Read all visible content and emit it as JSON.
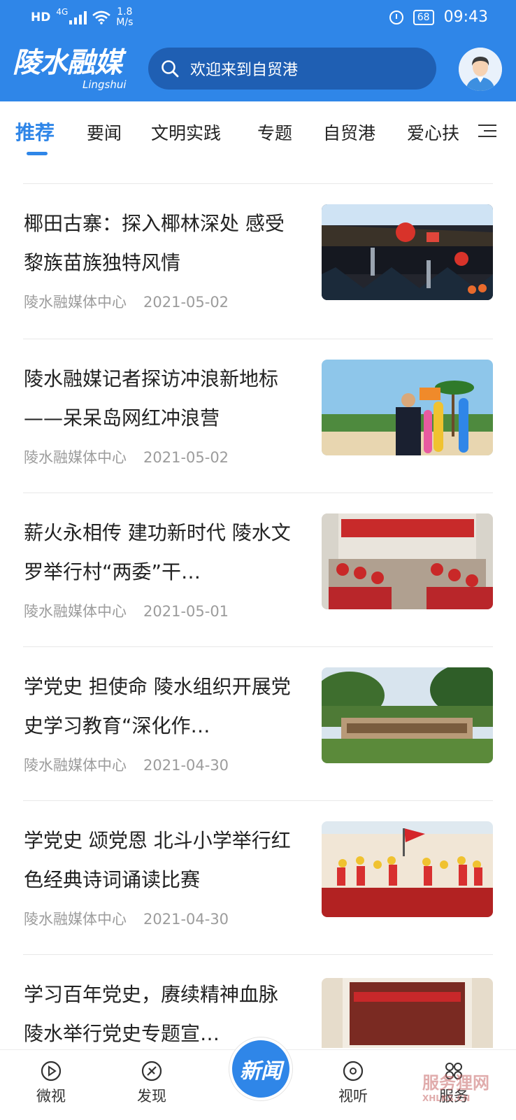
{
  "status_bar": {
    "network": "HD",
    "signal_type": "4G",
    "speed_value": "1.8",
    "speed_unit": "M/s",
    "battery": "68",
    "time": "09:43"
  },
  "app": {
    "logo_cn": "陵水融媒",
    "logo_en": "Lingshui"
  },
  "search": {
    "placeholder": "欢迎来到自贸港"
  },
  "tabs": [
    "推荐",
    "要闻",
    "文明实践",
    "专题",
    "自贸港",
    "爱心扶"
  ],
  "active_tab": 0,
  "feed": [
    {
      "title": "椰田古寨：探入椰林深处 感受黎族苗族独特风情",
      "source": "陵水融媒体中心",
      "date": "2021-05-02"
    },
    {
      "title": "陵水融媒记者探访冲浪新地标——呆呆岛网红冲浪营",
      "source": "陵水融媒体中心",
      "date": "2021-05-02"
    },
    {
      "title": "薪火永相传 建功新时代 陵水文罗举行村“两委”干…",
      "source": "陵水融媒体中心",
      "date": "2021-05-01"
    },
    {
      "title": "学党史 担使命 陵水组织开展党史学习教育“深化作…",
      "source": "陵水融媒体中心",
      "date": "2021-04-30"
    },
    {
      "title": "学党史 颂党恩 北斗小学举行红色经典诗词诵读比赛",
      "source": "陵水融媒体中心",
      "date": "2021-04-30"
    },
    {
      "title": "学习百年党史，赓续精神血脉 陵水举行党史专题宣…",
      "source": "",
      "date": ""
    }
  ],
  "bottom_nav": {
    "video": "微视",
    "discover": "发现",
    "center": "新闻",
    "watch": "视听",
    "services": "服务"
  },
  "watermark": {
    "text": "服务狸网",
    "domain": "XHLKS.CN"
  },
  "colors": {
    "brand": "#2f86e8",
    "search_bg": "#1f5fb3",
    "meta": "#9c9c9c"
  }
}
